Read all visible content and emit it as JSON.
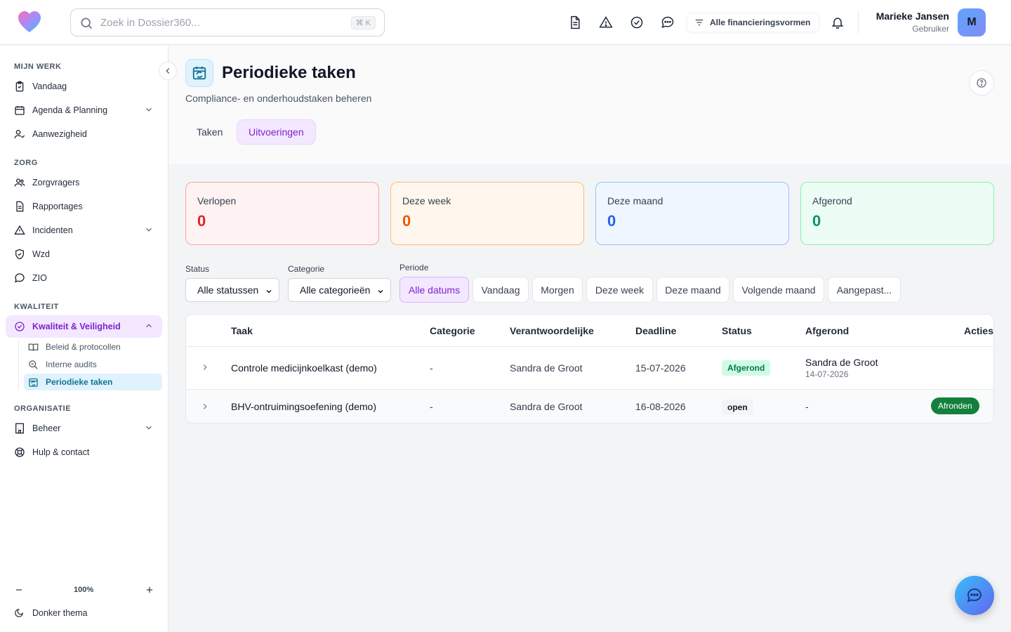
{
  "header": {
    "search_placeholder": "Zoek in Dossier360...",
    "search_shortcut": "⌘ K",
    "finance_filter": "Alle financieringsvormen",
    "user_name": "Marieke Jansen",
    "user_role": "Gebruiker",
    "avatar_initial": "M"
  },
  "sidebar": {
    "sections": {
      "mijn_werk": "MIJN WERK",
      "zorg": "ZORG",
      "kwaliteit": "KWALITEIT",
      "organisatie": "ORGANISATIE"
    },
    "items": {
      "vandaag": "Vandaag",
      "agenda": "Agenda & Planning",
      "aanwezigheid": "Aanwezigheid",
      "zorgvragers": "Zorgvragers",
      "rapportages": "Rapportages",
      "incidenten": "Incidenten",
      "wzd": "Wzd",
      "zio": "ZIO",
      "kwaliteit": "Kwaliteit & Veiligheid",
      "beleid": "Beleid & protocollen",
      "audits": "Interne audits",
      "periodiek": "Periodieke taken",
      "beheer": "Beheer",
      "hulp": "Hulp & contact"
    },
    "zoom": "100%",
    "theme": "Donker thema"
  },
  "page": {
    "title": "Periodieke taken",
    "subtitle": "Compliance- en onderhoudstaken beheren",
    "tabs": [
      "Taken",
      "Uitvoeringen"
    ],
    "active_tab": "Uitvoeringen"
  },
  "stats": [
    {
      "label": "Verlopen",
      "value": "0",
      "color": "#dc2626"
    },
    {
      "label": "Deze week",
      "value": "0",
      "color": "#ea580c"
    },
    {
      "label": "Deze maand",
      "value": "0",
      "color": "#2563eb"
    },
    {
      "label": "Afgerond",
      "value": "0",
      "color": "#059669"
    }
  ],
  "filters": {
    "status_label": "Status",
    "status_value": "Alle statussen",
    "category_label": "Categorie",
    "category_value": "Alle categorieën",
    "period_label": "Periode",
    "periods": [
      "Alle datums",
      "Vandaag",
      "Morgen",
      "Deze week",
      "Deze maand",
      "Volgende maand",
      "Aangepast..."
    ],
    "active_period": "Alle datums"
  },
  "table": {
    "headers": [
      "Taak",
      "Categorie",
      "Verantwoordelijke",
      "Deadline",
      "Status",
      "Afgerond",
      "Acties"
    ],
    "rows": [
      {
        "task": "Controle medicijnkoelkast (demo)",
        "category": "-",
        "owner": "Sandra de Groot",
        "deadline": "15-07-2026",
        "status": "Afgerond",
        "done_by": "Sandra de Groot",
        "done_date": "14-07-2026",
        "action": ""
      },
      {
        "task": "BHV-ontruimingsoefening (demo)",
        "category": "-",
        "owner": "Sandra de Groot",
        "deadline": "16-08-2026",
        "status": "open",
        "done_by": "-",
        "done_date": "",
        "action": "Afronden"
      }
    ]
  },
  "colors": {
    "accent": "#7e22ce",
    "active_sub": "#0e7490",
    "success": "#15803d"
  }
}
